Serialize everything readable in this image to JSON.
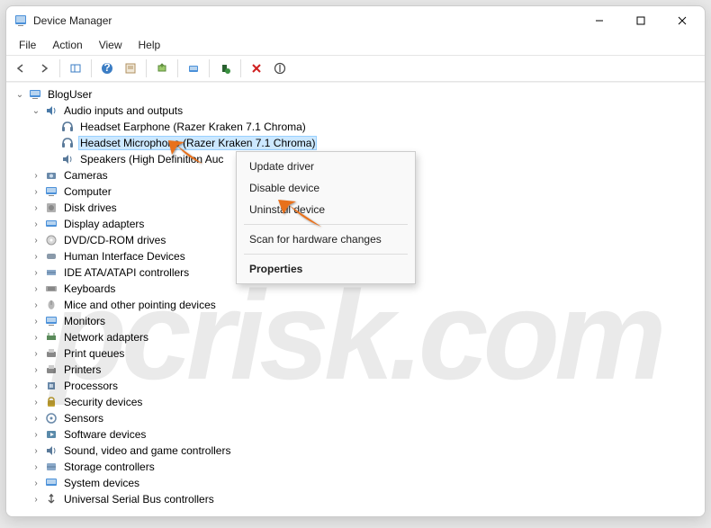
{
  "window": {
    "title": "Device Manager"
  },
  "menubar": {
    "file": "File",
    "action": "Action",
    "view": "View",
    "help": "Help"
  },
  "tree": {
    "root": "BlogUser",
    "audio_category": "Audio inputs and outputs",
    "audio_items": {
      "earphone": "Headset Earphone (Razer Kraken 7.1 Chroma)",
      "microphone": "Headset Microphone (Razer Kraken 7.1 Chroma)",
      "speakers": "Speakers (High Definition Auc"
    },
    "categories": {
      "cameras": "Cameras",
      "computer": "Computer",
      "disk_drives": "Disk drives",
      "display_adapters": "Display adapters",
      "dvd_cdrom": "DVD/CD-ROM drives",
      "hid": "Human Interface Devices",
      "ide": "IDE ATA/ATAPI controllers",
      "keyboards": "Keyboards",
      "mice": "Mice and other pointing devices",
      "monitors": "Monitors",
      "network": "Network adapters",
      "print_queues": "Print queues",
      "printers": "Printers",
      "processors": "Processors",
      "security": "Security devices",
      "sensors": "Sensors",
      "software": "Software devices",
      "sound": "Sound, video and game controllers",
      "storage": "Storage controllers",
      "system": "System devices",
      "usb": "Universal Serial Bus controllers"
    }
  },
  "context_menu": {
    "update": "Update driver",
    "disable": "Disable device",
    "uninstall": "Uninstall device",
    "scan": "Scan for hardware changes",
    "properties": "Properties"
  },
  "watermark": "pcrisk.com"
}
